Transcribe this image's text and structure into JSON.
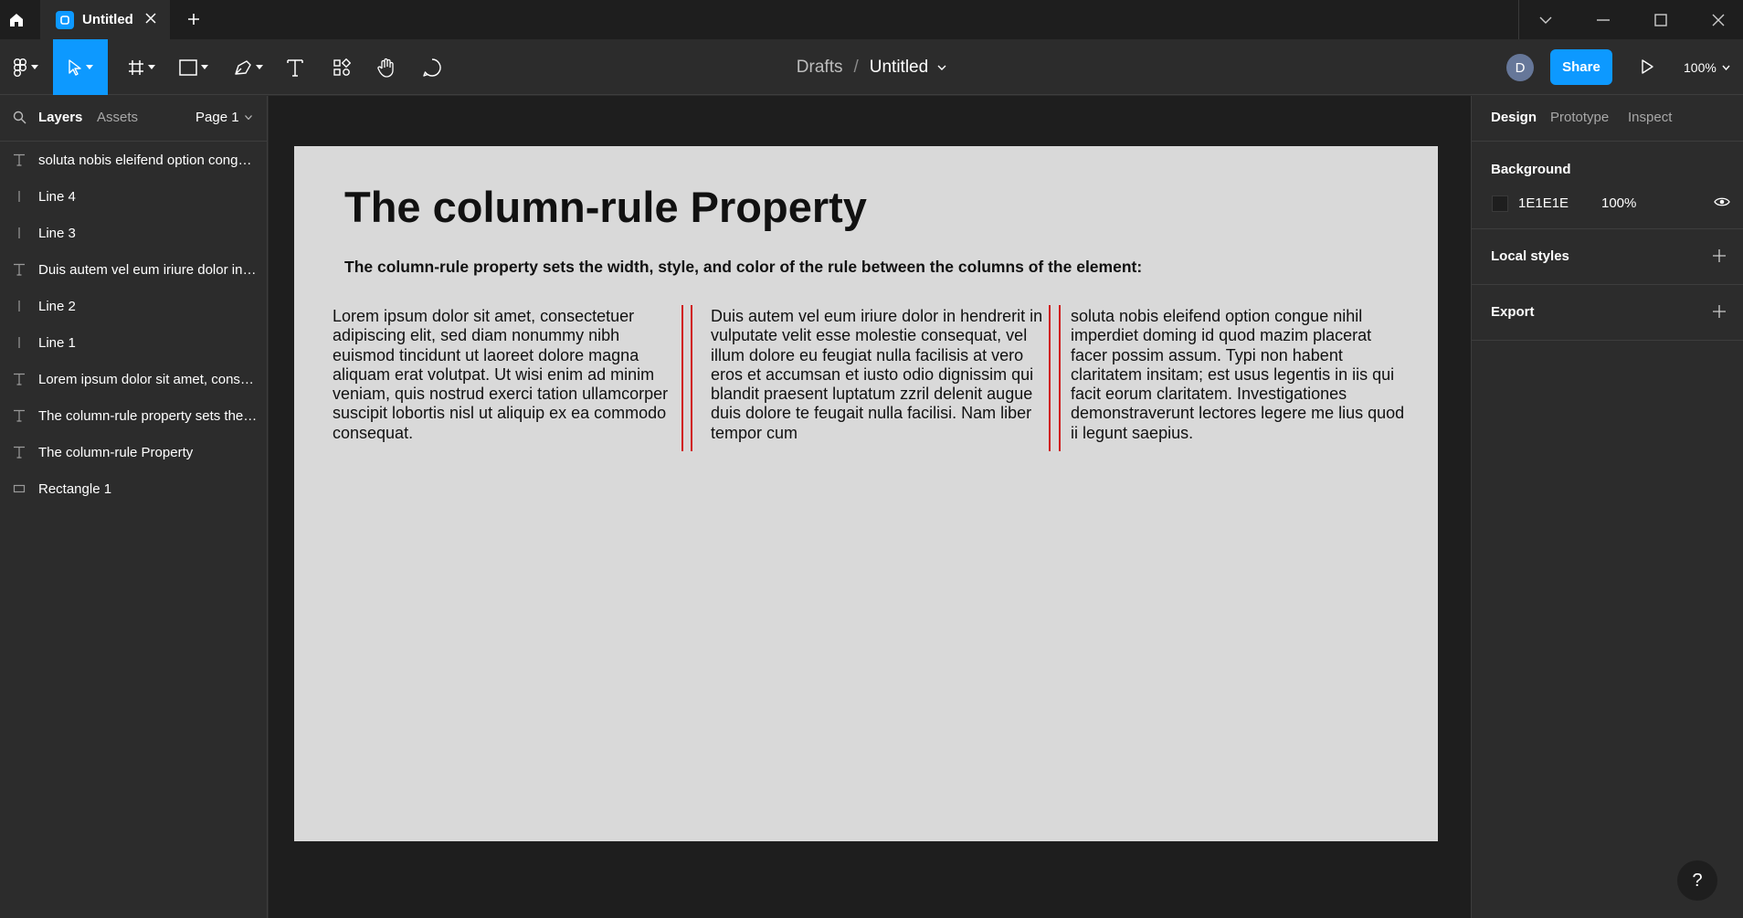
{
  "tab": {
    "title": "Untitled"
  },
  "breadcrumb": {
    "drafts": "Drafts",
    "separator": "/",
    "file": "Untitled"
  },
  "toolbar": {
    "share_label": "Share",
    "zoom": "100%",
    "avatar_initial": "D"
  },
  "left_panel": {
    "tabs": [
      "Layers",
      "Assets"
    ],
    "page_selector": "Page 1",
    "layers": [
      {
        "type": "text",
        "name": "soluta nobis eleifend option congue nihil imperdiet"
      },
      {
        "type": "line",
        "name": "Line 4"
      },
      {
        "type": "line",
        "name": "Line 3"
      },
      {
        "type": "text",
        "name": "Duis autem vel eum iriure dolor in hendrerit"
      },
      {
        "type": "line",
        "name": "Line 2"
      },
      {
        "type": "line",
        "name": "Line 1"
      },
      {
        "type": "text",
        "name": "Lorem ipsum dolor sit amet, consectetuer"
      },
      {
        "type": "text",
        "name": "The column-rule property sets the width"
      },
      {
        "type": "text",
        "name": "The column-rule Property"
      },
      {
        "type": "rectangle",
        "name": "Rectangle 1"
      }
    ]
  },
  "canvas": {
    "title": "The column-rule Property",
    "subtitle": "The column-rule property sets the width, style, and color of the rule between the columns of the element:",
    "columns": [
      "Lorem ipsum dolor sit amet, consectetuer adipiscing elit, sed diam nonummy nibh euismod tincidunt ut laoreet dolore magna aliquam erat volutpat. Ut wisi enim ad minim veniam, quis nostrud exerci tation ullamcorper suscipit lobortis nisl ut aliquip ex ea commodo consequat.",
      "Duis autem vel eum iriure dolor in hendrerit in vulputate velit esse molestie consequat, vel illum dolore eu feugiat nulla facilisis at vero eros et accumsan et iusto odio dignissim qui blandit praesent luptatum zzril delenit augue duis dolore te feugait nulla facilisi. Nam liber tempor cum",
      "soluta nobis eleifend option congue nihil imperdiet doming id quod mazim placerat facer possim assum. Typi non habent claritatem insitam; est usus legentis in iis qui facit eorum claritatem. Investigationes demonstraverunt lectores legere me lius quod ii legunt saepius."
    ],
    "rule_color": "#d01818",
    "frame_color": "#d9d9d9"
  },
  "right_panel": {
    "tabs": [
      "Design",
      "Prototype",
      "Inspect"
    ],
    "background": {
      "heading": "Background",
      "hex": "1E1E1E",
      "opacity": "100%"
    },
    "local_styles": "Local styles",
    "export": "Export"
  },
  "help": "?",
  "colors": {
    "accent": "#0d99ff",
    "panel": "#2c2c2c",
    "canvas": "#1e1e1e"
  }
}
